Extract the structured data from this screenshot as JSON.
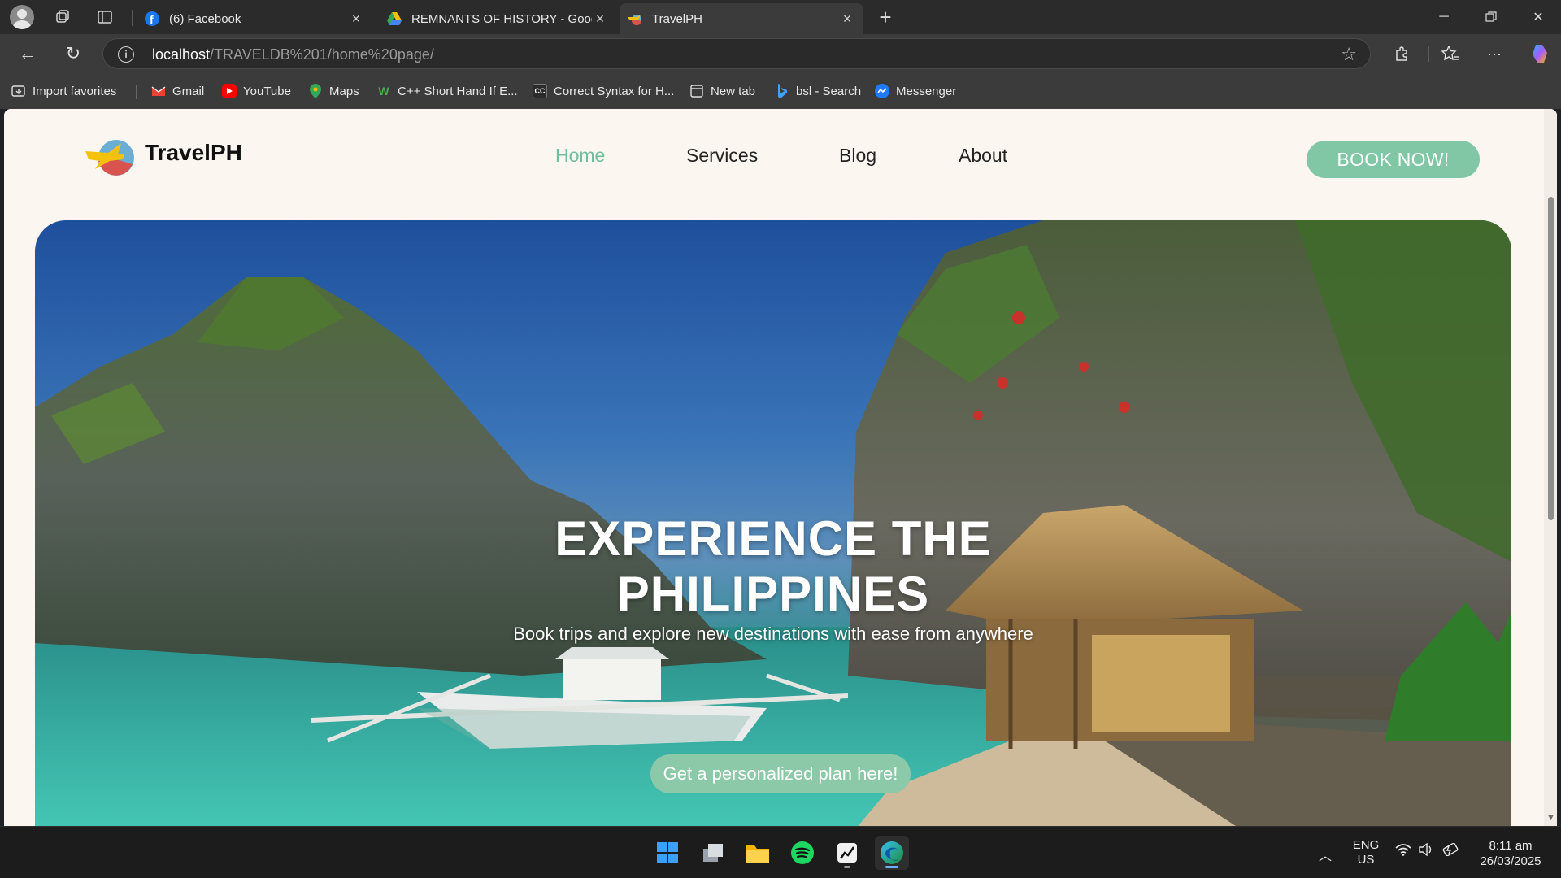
{
  "browser": {
    "tabs": [
      {
        "title": "(6) Facebook",
        "active": false
      },
      {
        "title": "REMNANTS OF HISTORY - Google",
        "active": false
      },
      {
        "title": "TravelPH",
        "active": true
      }
    ],
    "url_host": "localhost",
    "url_path": "/TRAVELDB%201/home%20page/",
    "bookmarks": [
      {
        "label": "Import favorites"
      },
      {
        "label": "Gmail"
      },
      {
        "label": "YouTube"
      },
      {
        "label": "Maps"
      },
      {
        "label": "C++ Short Hand If E..."
      },
      {
        "label": "Correct Syntax for H..."
      },
      {
        "label": "New tab"
      },
      {
        "label": "bsl - Search"
      },
      {
        "label": "Messenger"
      }
    ]
  },
  "site": {
    "brand": "TravelPH",
    "nav": [
      {
        "label": "Home",
        "active": true
      },
      {
        "label": "Services",
        "active": false
      },
      {
        "label": "Blog",
        "active": false
      },
      {
        "label": "About",
        "active": false
      }
    ],
    "book_button": "BOOK NOW!",
    "hero": {
      "title_line1": "EXPERIENCE THE",
      "title_line2": "PHILIPPINES",
      "subtitle": "Book trips and explore new destinations with ease from anywhere",
      "cta": "Get a personalized plan here!"
    },
    "colors": {
      "accent": "#82c7a5",
      "nav_active": "#6fbf9e",
      "page_bg": "#fbf6f0"
    }
  },
  "taskbar": {
    "language_line1": "ENG",
    "language_line2": "US",
    "time": "8:11 am",
    "date": "26/03/2025"
  }
}
